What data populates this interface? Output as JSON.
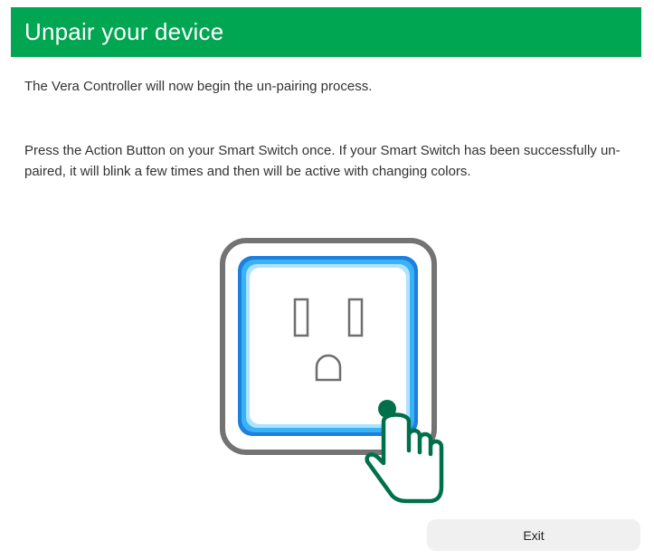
{
  "header": {
    "title": "Unpair your device",
    "background_color": "#00a651"
  },
  "main": {
    "intro_text": "The Vera Controller will now begin the un-pairing process.",
    "instruction_text": "Press the Action Button on your Smart Switch once. If your Smart Switch has been successfully un-paired, it will blink a few times and then will be active with changing colors."
  },
  "illustration": {
    "icons": [
      "smart-switch-outlet-icon",
      "hand-pointer-icon"
    ],
    "accent_color": "#1a9be8",
    "hand_color": "#00704a"
  },
  "footer": {
    "exit_label": "Exit"
  }
}
